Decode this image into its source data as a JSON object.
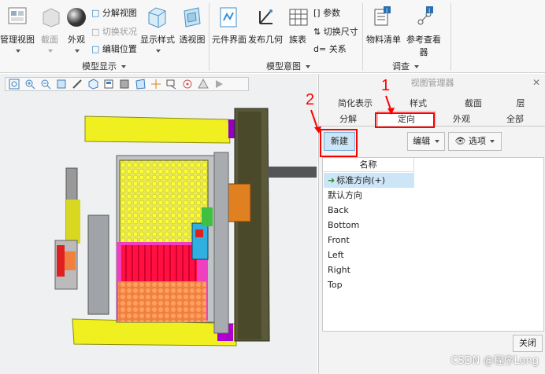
{
  "ribbon": {
    "manage_views": "管理视图",
    "section": "截面",
    "appearance": "外观",
    "explode_view": "分解视图",
    "toggle_status": "切换状况",
    "edit_position": "编辑位置",
    "display_style": "显示样式",
    "perspective_view": "透视图",
    "element_interface": "元件界面",
    "publish_geometry": "发布几何",
    "family_table": "族表",
    "parameters": "参数",
    "toggle_dimensions": "切换尺寸",
    "relations": "关系",
    "bill_of_materials": "物料清单",
    "reference_viewer": "参考查看器",
    "group_model_display": "模型显示",
    "group_model_intent": "模型意图",
    "group_investigate": "调查"
  },
  "panel": {
    "title": "视图管理器",
    "tabs_row1": [
      "简化表示",
      "样式",
      "截面",
      "层"
    ],
    "tabs_row2": [
      "分解",
      "定向",
      "外观",
      "全部"
    ],
    "new_button": "新建",
    "edit_button": "编辑",
    "options_button": "选项",
    "list_header": "名称",
    "items": [
      "标准方向(+)",
      "默认方向",
      "Back",
      "Bottom",
      "Front",
      "Left",
      "Right",
      "Top"
    ],
    "close_button": "关闭"
  },
  "annotations": {
    "n1": "1",
    "n2": "2"
  },
  "watermark": "CSDN @程序Long"
}
